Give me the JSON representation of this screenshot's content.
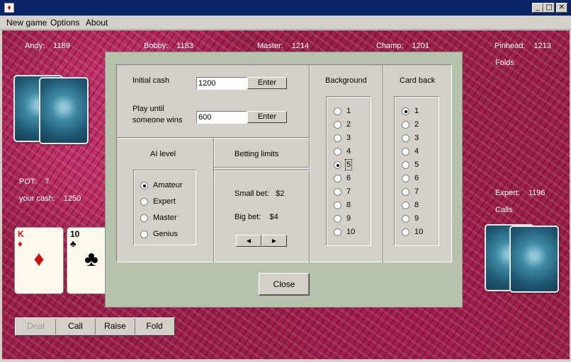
{
  "window": {
    "min_glyph": "_",
    "max_glyph": "□",
    "close_glyph": "✕"
  },
  "menu": [
    {
      "label": "New game"
    },
    {
      "label": "Options"
    },
    {
      "label": "About"
    }
  ],
  "players": [
    {
      "name": "Andy:",
      "cash": "1189"
    },
    {
      "name": "Bobby:",
      "cash": "1183"
    },
    {
      "name": "Master:",
      "cash": "1214"
    },
    {
      "name": "Champ:",
      "cash": "1201"
    },
    {
      "name": "Pinhead:",
      "cash": "1213",
      "status": "Folds"
    },
    {
      "name": "Expert:",
      "cash": "1196",
      "status": "Calls"
    }
  ],
  "pot": {
    "label": "POT:",
    "value": "7"
  },
  "your_cash": {
    "label": "your cash:",
    "value": "1250"
  },
  "hand": [
    {
      "rank": "K",
      "suit": "♦",
      "color": "#cc1010"
    },
    {
      "rank": "10",
      "suit": "♣",
      "color": "#000000"
    }
  ],
  "actions": [
    {
      "label": "Deal",
      "enabled": false
    },
    {
      "label": "Call",
      "enabled": true
    },
    {
      "label": "Raise",
      "enabled": true
    },
    {
      "label": "Fold",
      "enabled": true
    }
  ],
  "dialog": {
    "initial_cash_label": "Initial cash",
    "initial_cash_value": "1200",
    "play_until_label_1": "Play until",
    "play_until_label_2": "someone wins",
    "play_until_value": "600",
    "enter_label": "Enter",
    "ai_level_title": "AI level",
    "ai_levels": [
      {
        "label": "Amateur",
        "selected": true
      },
      {
        "label": "Expert",
        "selected": false
      },
      {
        "label": "Master",
        "selected": false
      },
      {
        "label": "Genius",
        "selected": false
      }
    ],
    "betting_title": "Betting limits",
    "small_bet": "Small bet:   $2",
    "big_bet": "Big bet:    $4",
    "prev_glyph": "◀",
    "next_glyph": "▶",
    "background_title": "Background",
    "background_options": [
      "1",
      "2",
      "3",
      "4",
      "5",
      "6",
      "7",
      "8",
      "9",
      "10"
    ],
    "background_selected": "5",
    "cardback_title": "Card back",
    "cardback_options": [
      "1",
      "2",
      "3",
      "4",
      "5",
      "6",
      "7",
      "8",
      "9",
      "10"
    ],
    "cardback_selected": "1",
    "close_label": "Close"
  },
  "colors": {
    "titlebar": "#0a246a",
    "table_felt": "#9b1f4b",
    "dialog_bg": "#b6c1ae",
    "panel_bg": "#d4d0c8"
  }
}
